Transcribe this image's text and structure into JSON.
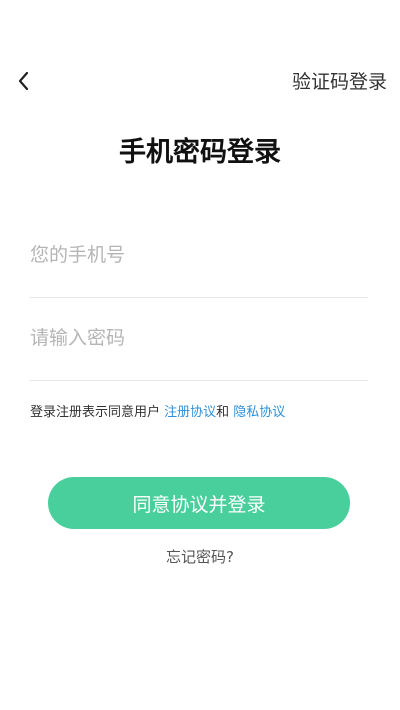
{
  "header": {
    "back_icon": "chevron-left-icon",
    "switch_label": "验证码登录"
  },
  "title": "手机密码登录",
  "form": {
    "phone_placeholder": "您的手机号",
    "phone_value": "",
    "password_placeholder": "请输入密码",
    "password_value": ""
  },
  "agreement": {
    "prefix": "登录注册表示同意用户 ",
    "terms_label": "注册协议",
    "connector": "和 ",
    "privacy_label": "隐私协议"
  },
  "actions": {
    "login_label": "同意协议并登录",
    "forgot_label": "忘记密码?"
  },
  "colors": {
    "accent": "#48cf9c",
    "link": "#2f8fd8"
  }
}
